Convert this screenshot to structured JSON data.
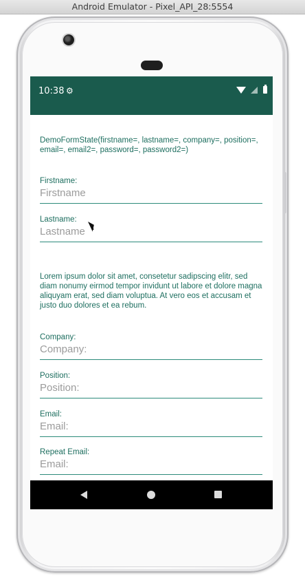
{
  "window": {
    "title": "Android Emulator - Pixel_API_28:5554"
  },
  "statusbar": {
    "time": "10:38",
    "color": "#1a5b4d"
  },
  "form": {
    "state_text": "DemoFormState(firstname=, lastname=, company=, position=, email=, email2=, password=, password2=)",
    "lorem": "Lorem ipsum dolor sit amet, consetetur sadipscing elitr, sed diam nonumy eirmod tempor invidunt ut labore et dolore magna aliquyam erat, sed diam voluptua. At vero eos et accusam et justo duo dolores et ea rebum.",
    "fields": [
      {
        "label": "Firstname:",
        "value": "",
        "placeholder": "Firstname"
      },
      {
        "label": "Lastname:",
        "value": "",
        "placeholder": "Lastname"
      },
      {
        "label": "Company:",
        "value": "",
        "placeholder": "Company:"
      },
      {
        "label": "Position:",
        "value": "",
        "placeholder": "Position:"
      },
      {
        "label": "Email:",
        "value": "",
        "placeholder": "Email:"
      },
      {
        "label": "Repeat Email:",
        "value": "",
        "placeholder": "Email:"
      }
    ]
  },
  "icons": {
    "settings": "gear-icon",
    "wifi": "wifi-icon",
    "signal": "signal-icon",
    "battery": "battery-icon",
    "back": "back-icon",
    "home": "home-icon",
    "recents": "recents-icon"
  },
  "theme": {
    "accent": "#1d6e5f",
    "underline": "#2b8a7a"
  }
}
